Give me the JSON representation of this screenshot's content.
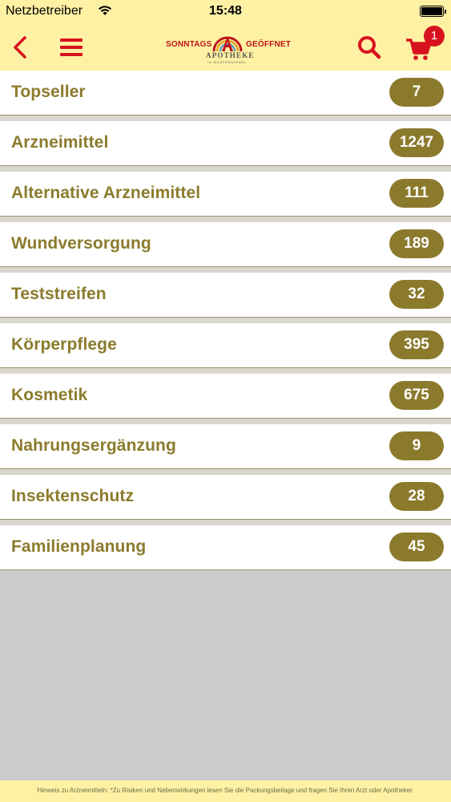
{
  "status_bar": {
    "carrier": "Netzbetreiber",
    "time": "15:48"
  },
  "nav": {
    "back_icon": "back-chevron-icon",
    "menu_icon": "hamburger-menu-icon",
    "search_icon": "search-icon",
    "cart_icon": "cart-icon",
    "cart_count": "1",
    "logo": {
      "left_text": "SONNTAGS",
      "right_text": "GEÖFFNET",
      "word": "APOTHEKE",
      "sub": "IN WASPERDIRNDL"
    }
  },
  "categories": [
    {
      "label": "Topseller",
      "count": "7"
    },
    {
      "label": "Arzneimittel",
      "count": "1247"
    },
    {
      "label": "Alternative Arzneimittel",
      "count": "111"
    },
    {
      "label": "Wundversorgung",
      "count": "189"
    },
    {
      "label": "Teststreifen",
      "count": "32"
    },
    {
      "label": "Körperpflege",
      "count": "395"
    },
    {
      "label": "Kosmetik",
      "count": "675"
    },
    {
      "label": "Nahrungsergänzung",
      "count": "9"
    },
    {
      "label": "Insektenschutz",
      "count": "28"
    },
    {
      "label": "Familienplanung",
      "count": "45"
    }
  ],
  "footer": {
    "text": "Hinweis zu Arzneimitteln: *Zu Risiken und Nebenwirkungen lesen Sie die Packungsbeilage und fragen Sie Ihren Arzt oder Apotheker."
  },
  "colors": {
    "header_bg": "#fff1a3",
    "accent_red": "#d7121e",
    "olive": "#8b7a2c",
    "content_bg": "#cbcbcb"
  }
}
